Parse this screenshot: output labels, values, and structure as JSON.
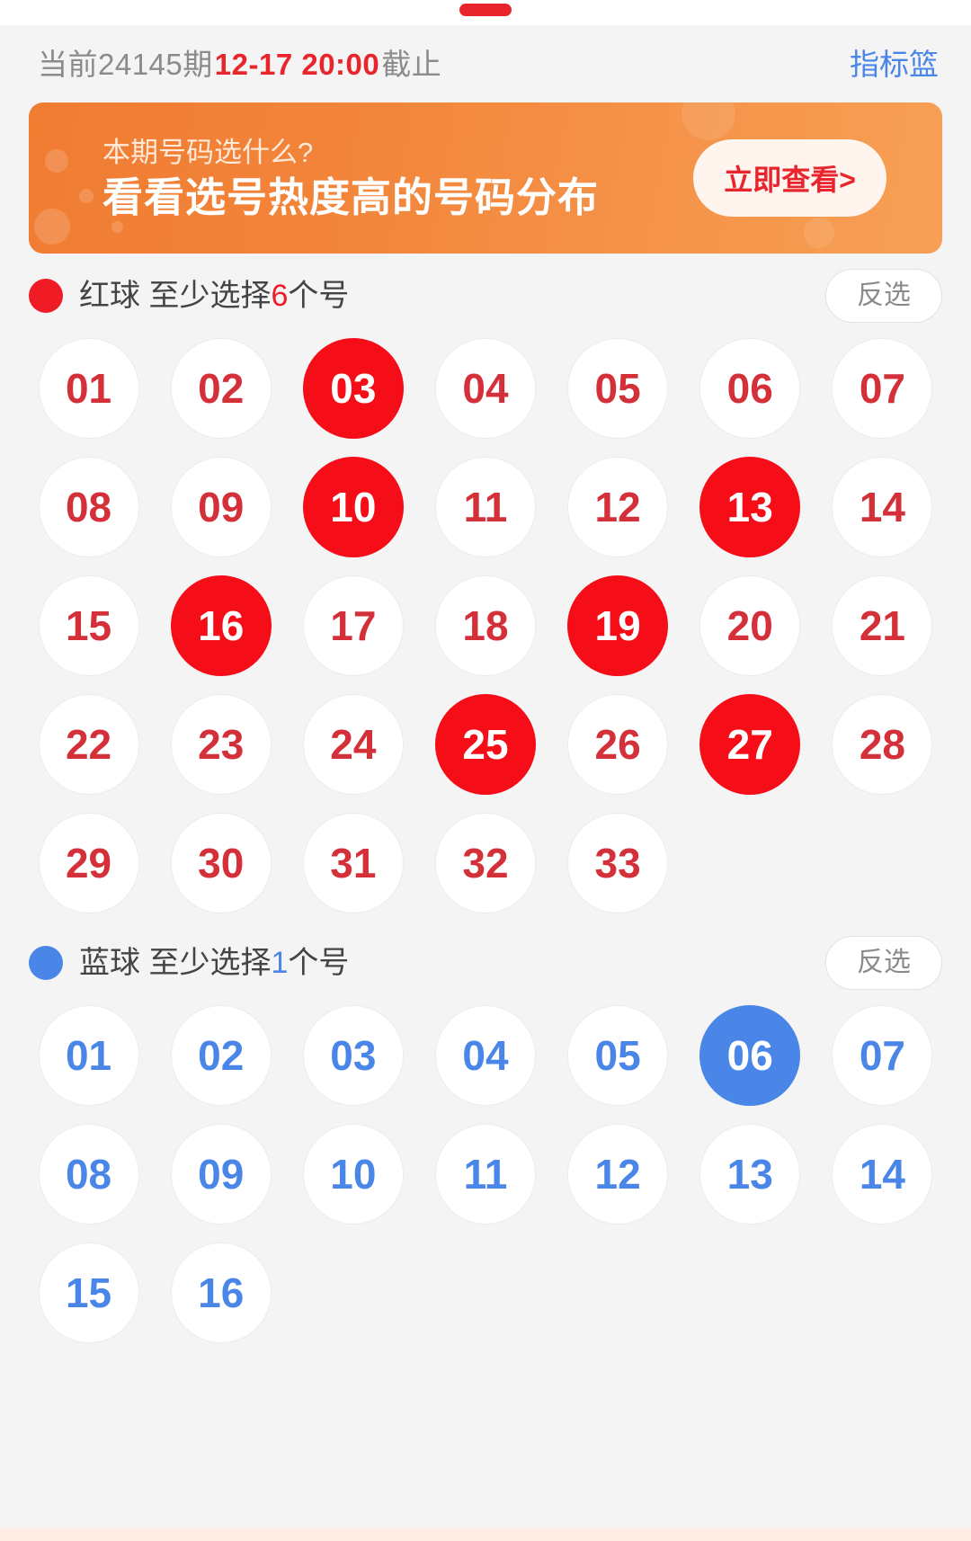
{
  "header": {
    "tab_indicator": "active-tab-indicator",
    "period_prefix": "当前24145期",
    "deadline": "12-17 20:00",
    "period_suffix": "截止",
    "basket_link": "指标篮"
  },
  "banner": {
    "subtitle": "本期号码选什么?",
    "title": "看看选号热度高的号码分布",
    "cta": "立即查看>",
    "bg_start": "#f07c32",
    "bg_end": "#f7a055",
    "cta_color": "#e8252c"
  },
  "red_section": {
    "dot_color": "#ef1b25",
    "label_prefix": "红球 至少选择",
    "min_count": "6",
    "label_suffix": "个号",
    "invert_label": "反选",
    "balls": [
      {
        "n": "01",
        "selected": false
      },
      {
        "n": "02",
        "selected": false
      },
      {
        "n": "03",
        "selected": true
      },
      {
        "n": "04",
        "selected": false
      },
      {
        "n": "05",
        "selected": false
      },
      {
        "n": "06",
        "selected": false
      },
      {
        "n": "07",
        "selected": false
      },
      {
        "n": "08",
        "selected": false
      },
      {
        "n": "09",
        "selected": false
      },
      {
        "n": "10",
        "selected": true
      },
      {
        "n": "11",
        "selected": false
      },
      {
        "n": "12",
        "selected": false
      },
      {
        "n": "13",
        "selected": true
      },
      {
        "n": "14",
        "selected": false
      },
      {
        "n": "15",
        "selected": false
      },
      {
        "n": "16",
        "selected": true
      },
      {
        "n": "17",
        "selected": false
      },
      {
        "n": "18",
        "selected": false
      },
      {
        "n": "19",
        "selected": true
      },
      {
        "n": "20",
        "selected": false
      },
      {
        "n": "21",
        "selected": false
      },
      {
        "n": "22",
        "selected": false
      },
      {
        "n": "23",
        "selected": false
      },
      {
        "n": "24",
        "selected": false
      },
      {
        "n": "25",
        "selected": true
      },
      {
        "n": "26",
        "selected": false
      },
      {
        "n": "27",
        "selected": true
      },
      {
        "n": "28",
        "selected": false
      },
      {
        "n": "29",
        "selected": false
      },
      {
        "n": "30",
        "selected": false
      },
      {
        "n": "31",
        "selected": false
      },
      {
        "n": "32",
        "selected": false
      },
      {
        "n": "33",
        "selected": false
      }
    ],
    "selected_numbers": [
      "03",
      "10",
      "13",
      "16",
      "19",
      "25",
      "27"
    ]
  },
  "blue_section": {
    "dot_color": "#4a86e8",
    "label_prefix": "蓝球 至少选择",
    "min_count": "1",
    "label_suffix": "个号",
    "invert_label": "反选",
    "balls": [
      {
        "n": "01",
        "selected": false
      },
      {
        "n": "02",
        "selected": false
      },
      {
        "n": "03",
        "selected": false
      },
      {
        "n": "04",
        "selected": false
      },
      {
        "n": "05",
        "selected": false
      },
      {
        "n": "06",
        "selected": true
      },
      {
        "n": "07",
        "selected": false
      },
      {
        "n": "08",
        "selected": false
      },
      {
        "n": "09",
        "selected": false
      },
      {
        "n": "10",
        "selected": false
      },
      {
        "n": "11",
        "selected": false
      },
      {
        "n": "12",
        "selected": false
      },
      {
        "n": "13",
        "selected": false
      },
      {
        "n": "14",
        "selected": false
      },
      {
        "n": "15",
        "selected": false
      },
      {
        "n": "16",
        "selected": false
      }
    ],
    "selected_numbers": [
      "06"
    ]
  }
}
